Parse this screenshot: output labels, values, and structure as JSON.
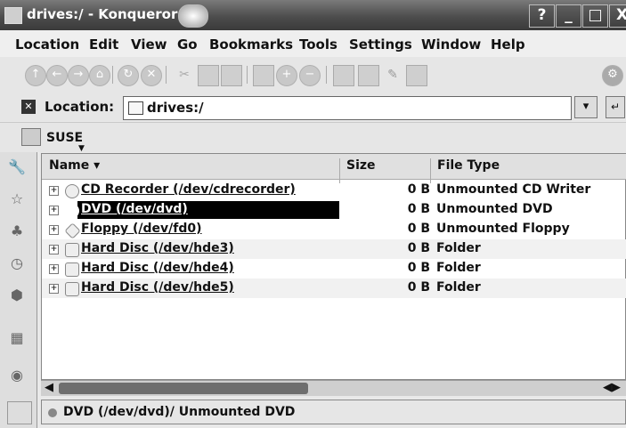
{
  "window": {
    "title": "drives:/ - Konqueror",
    "buttons": [
      "?",
      "_",
      "□",
      "X"
    ]
  },
  "menu": [
    "Location",
    "Edit",
    "View",
    "Go",
    "Bookmarks",
    "Tools",
    "Settings",
    "Window",
    "Help"
  ],
  "toolbar": {
    "icons": [
      "up-icon",
      "back-icon",
      "forward-icon",
      "home-icon",
      "reload-icon",
      "stop-icon",
      "cut-icon",
      "copy-icon",
      "paste-icon",
      "print-icon",
      "zoom-in-icon",
      "zoom-out-icon",
      "icon-view-icon",
      "detail-view-icon",
      "bookmark-icon",
      "settings-icon"
    ]
  },
  "location": {
    "label": "Location:",
    "value": "drives:/"
  },
  "bookmarks_bar": {
    "label": "SUSE"
  },
  "columns": [
    "Name",
    "Size",
    "File Type"
  ],
  "files": [
    {
      "name": "CD Recorder (/dev/cdrecorder)",
      "size": "0 B",
      "type": "Unmounted CD Writer",
      "selected": false
    },
    {
      "name": "DVD (/dev/dvd)",
      "size": "0 B",
      "type": "Unmounted DVD",
      "selected": true
    },
    {
      "name": "Floppy (/dev/fd0)",
      "size": "0 B",
      "type": "Unmounted Floppy",
      "selected": false
    },
    {
      "name": "Hard Disc (/dev/hde3)",
      "size": "0 B",
      "type": "Folder",
      "selected": false
    },
    {
      "name": "Hard Disc (/dev/hde4)",
      "size": "0 B",
      "type": "Folder",
      "selected": false
    },
    {
      "name": "Hard Disc (/dev/hde5)",
      "size": "0 B",
      "type": "Folder",
      "selected": false
    }
  ],
  "status": "DVD (/dev/dvd)/  Unmounted DVD"
}
